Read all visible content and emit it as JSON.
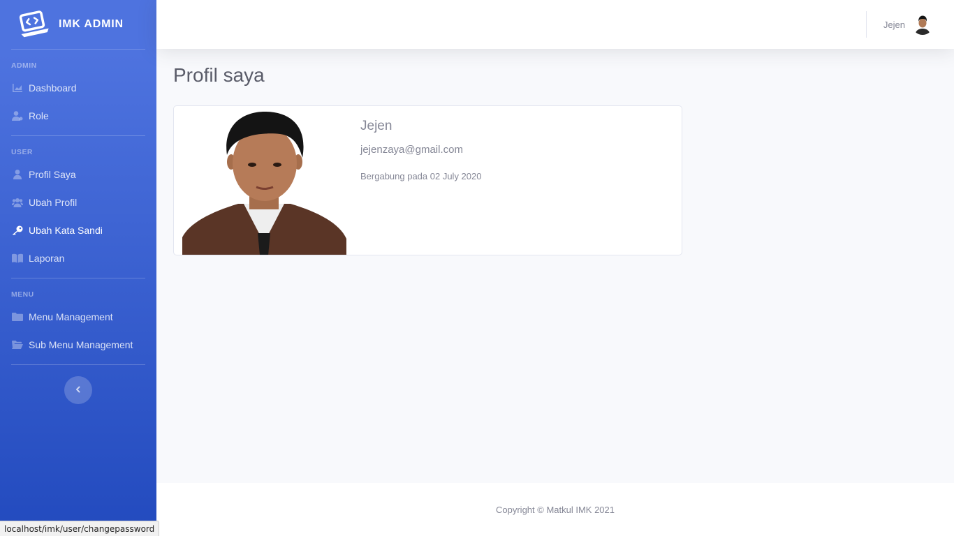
{
  "brand": {
    "title": "IMK ADMIN"
  },
  "sidebar": {
    "sections": [
      {
        "heading": "ADMIN",
        "items": [
          {
            "label": "Dashboard",
            "icon": "chart-area-icon"
          },
          {
            "label": "Role",
            "icon": "user-tie-icon"
          }
        ]
      },
      {
        "heading": "USER",
        "items": [
          {
            "label": "Profil Saya",
            "icon": "user-icon"
          },
          {
            "label": "Ubah Profil",
            "icon": "users-icon"
          },
          {
            "label": "Ubah Kata Sandi",
            "icon": "key-icon"
          },
          {
            "label": "Laporan",
            "icon": "book-open-icon"
          }
        ]
      },
      {
        "heading": "MENU",
        "items": [
          {
            "label": "Menu Management",
            "icon": "folder-icon"
          },
          {
            "label": "Sub Menu Management",
            "icon": "folder-open-icon"
          }
        ]
      }
    ]
  },
  "topbar": {
    "user_name": "Jejen"
  },
  "main": {
    "page_title": "Profil saya",
    "profile": {
      "name": "Jejen",
      "email": "jejenzaya@gmail.com",
      "joined": "Bergabung pada 02 July 2020"
    }
  },
  "footer": {
    "copyright": "Copyright © Matkul IMK 2021"
  },
  "statusbar": {
    "url": "localhost/imk/user/changepassword"
  },
  "colors": {
    "sidebar_top": "#4e73df",
    "sidebar_bottom": "#224abe",
    "text_muted": "#858796",
    "page_bg": "#f8f9fc"
  }
}
